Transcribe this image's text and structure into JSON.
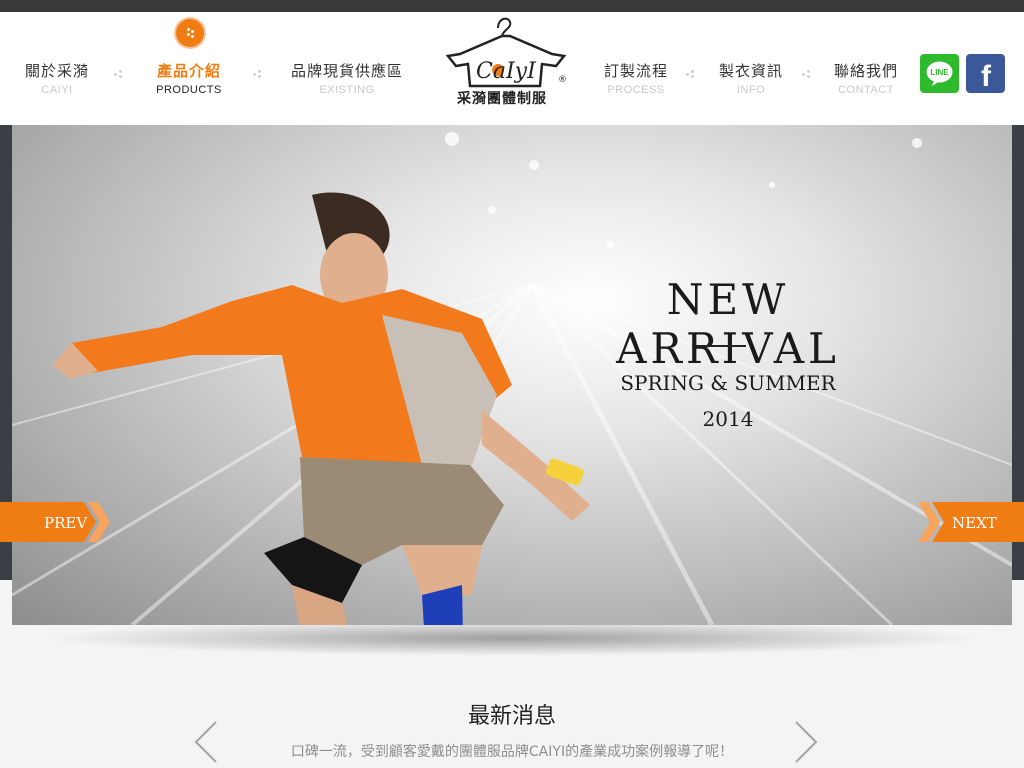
{
  "nav": {
    "items": [
      {
        "zh": "關於采漪",
        "en": "CAIYI"
      },
      {
        "zh": "產品介紹",
        "en": "PRODUCTS"
      },
      {
        "zh": "品牌現貨供應區",
        "en": "EXISTING"
      },
      {
        "zh": "訂製流程",
        "en": "PROCESS"
      },
      {
        "zh": "製衣資訊",
        "en": "INFO"
      },
      {
        "zh": "聯絡我們",
        "en": "CONTACT"
      }
    ],
    "active_index": 1
  },
  "logo": {
    "brand": "CaIyI",
    "registered": "®",
    "tagline": "采漪團體制服"
  },
  "social": {
    "line_label": "LINE",
    "facebook_label": "f"
  },
  "hero": {
    "title": "NEW ARRIVAL",
    "subtitle": "SPRING & SUMMER",
    "year": "2014",
    "prev_label": "PREV",
    "next_label": "NEXT"
  },
  "news": {
    "title": "最新消息",
    "text": "口碑一流，受到顧客愛戴的團體服品牌CAIYI的產業成功案例報導了呢！"
  },
  "colors": {
    "accent": "#f07d14",
    "line_green": "#2dbb2d",
    "facebook_blue": "#3b5998"
  }
}
